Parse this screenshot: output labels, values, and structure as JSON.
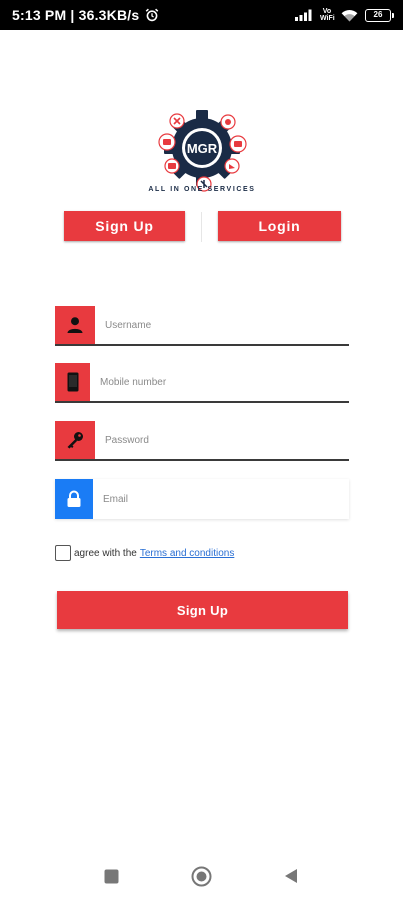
{
  "status_bar": {
    "time_speed": "5:13 PM | 36.3KB/s",
    "alarm_icon": "alarm-clock-icon",
    "signal_icon": "cellular-signal-icon",
    "volte_label": "Vo WiFi",
    "wifi_icon": "wifi-icon",
    "battery_level": "26"
  },
  "logo": {
    "brand": "MGR",
    "tagline": "ALL IN ONE SERVICES"
  },
  "tabs": {
    "signup_label": "Sign Up",
    "login_label": "Login"
  },
  "form": {
    "username": {
      "placeholder": "Username",
      "value": "",
      "icon": "person-icon"
    },
    "mobile": {
      "placeholder": "Mobile number",
      "value": "",
      "icon": "phone-icon"
    },
    "password": {
      "placeholder": "Password",
      "value": "",
      "icon": "key-icon"
    },
    "email": {
      "placeholder": "Email",
      "value": "",
      "icon": "lock-icon"
    }
  },
  "terms": {
    "prefix": "agree with the",
    "link": "Terms and conditions",
    "checked": false
  },
  "submit_label": "Sign Up",
  "nav": {
    "recents_icon": "square-recents-icon",
    "home_icon": "circle-home-icon",
    "back_icon": "triangle-back-icon"
  },
  "colors": {
    "accent_red": "#e83a3f",
    "email_blue": "#1a7cf5",
    "link_blue": "#2a6fd4",
    "logo_navy": "#1a2b46"
  }
}
